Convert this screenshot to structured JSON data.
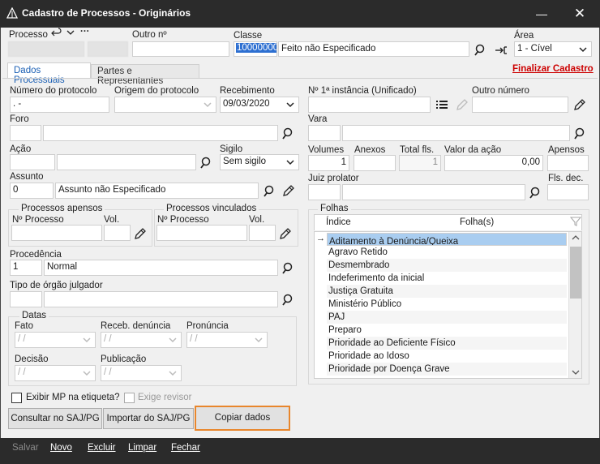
{
  "window": {
    "title": "Cadastro de Processos - Originários",
    "controls": {
      "minimize": "—",
      "restore": "◻",
      "close": "✕"
    }
  },
  "header": {
    "processo_label": "Processo",
    "outro_n_label": "Outro nº",
    "classe_label": "Classe",
    "classe_code": "10000000",
    "classe_desc": "Feito não Especificado",
    "area_label": "Área",
    "area_value": "1 - Cível"
  },
  "tabs": {
    "dados": "Dados Processuais",
    "partes": "Partes e Representantes",
    "finalizar": "Finalizar Cadastro",
    "finalizar_color": "#cc0000"
  },
  "left": {
    "numero_protocolo_label": "Número do protocolo",
    "numero_protocolo_value": ".      -",
    "origem_label": "Origem do protocolo",
    "recebimento_label": "Recebimento",
    "recebimento_value": "09/03/2020",
    "foro_label": "Foro",
    "acao_label": "Ação",
    "sigilo_label": "Sigilo",
    "sigilo_value": "Sem sigilo",
    "assunto_label": "Assunto",
    "assunto_code": "0",
    "assunto_desc": "Assunto não Especificado",
    "apensos_title": "Processos apensos",
    "vinculados_title": "Processos vinculados",
    "nprocesso_label": "Nº Processo",
    "vol_label": "Vol.",
    "procedencia_label": "Procedência",
    "procedencia_code": "1",
    "procedencia_desc": "Normal",
    "tipo_orgao_label": "Tipo de órgão julgador",
    "datas_title": "Datas",
    "fato_label": "Fato",
    "receb_denuncia_label": "Receb. denúncia",
    "pronuncia_label": "Pronúncia",
    "decisao_label": "Decisão",
    "publicacao_label": "Publicação",
    "date_placeholder": "/  /",
    "exibir_mp_label": "Exibir MP na etiqueta?",
    "exige_revisor_label": "Exige revisor"
  },
  "right": {
    "n1_instancia_label": "Nº 1ª instância (Unificado)",
    "outro_numero_label": "Outro número",
    "vara_label": "Vara",
    "volumes_label": "Volumes",
    "volumes_value": "1",
    "anexos_label": "Anexos",
    "total_fls_label": "Total fls.",
    "total_fls_value": "1",
    "valor_acao_label": "Valor da ação",
    "valor_acao_value": "0,00",
    "apensos_label": "Apensos",
    "juiz_label": "Juiz prolator",
    "fls_dec_label": "Fls. dec.",
    "folhas_title": "Folhas",
    "col_indice": "Índice",
    "col_folhas": "Folha(s)",
    "folhas_items": [
      "Aditamento à Denúncia/Queixa",
      "Agravo Retido",
      "Desmembrado",
      "Indeferimento da inicial",
      "Justiça Gratuita",
      "Ministério Público",
      "PAJ",
      "Preparo",
      "Prioridade ao Deficiente Físico",
      "Prioridade ao Idoso",
      "Prioridade por Doença Grave"
    ]
  },
  "buttons": {
    "consultar": "Consultar no SAJ/PG",
    "importar": "Importar do SAJ/PG",
    "copiar": "Copiar dados"
  },
  "toolbar": {
    "salvar": "Salvar",
    "novo": "Novo",
    "excluir": "Excluir",
    "limpar": "Limpar",
    "fechar": "Fechar"
  }
}
